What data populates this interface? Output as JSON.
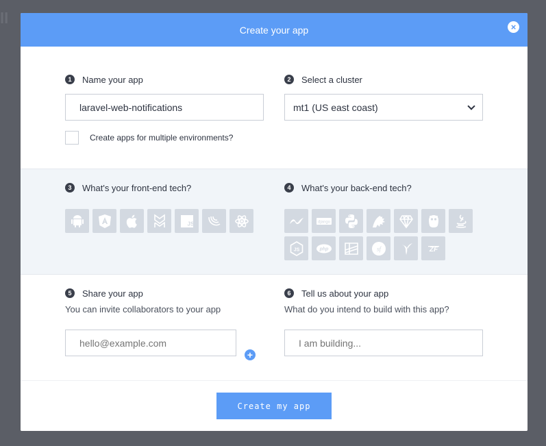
{
  "modal": {
    "title": "Create your app",
    "close_symbol": "×"
  },
  "name_app": {
    "step": "1",
    "label": "Name your app",
    "value": "laravel-web-notifications"
  },
  "cluster": {
    "step": "2",
    "label": "Select a cluster",
    "selected": "mt1 (US east coast)"
  },
  "multi_env": {
    "label": "Create apps for multiple environments?",
    "checked": false
  },
  "frontend": {
    "step": "3",
    "label": "What's your front-end tech?",
    "items": [
      {
        "name": "android-icon"
      },
      {
        "name": "angular-icon"
      },
      {
        "name": "apple-icon"
      },
      {
        "name": "backbone-icon"
      },
      {
        "name": "js-icon",
        "text": "JS"
      },
      {
        "name": "jquery-icon"
      },
      {
        "name": "react-icon"
      }
    ]
  },
  "backend": {
    "step": "4",
    "label": "What's your back-end tech?",
    "items": [
      {
        "name": "dotnet-icon"
      },
      {
        "name": "django-icon",
        "text": "django"
      },
      {
        "name": "python-icon"
      },
      {
        "name": "laravel-icon"
      },
      {
        "name": "ruby-icon"
      },
      {
        "name": "go-icon"
      },
      {
        "name": "java-icon"
      },
      {
        "name": "nodejs-icon",
        "text": "JS"
      },
      {
        "name": "php-icon",
        "text": "php"
      },
      {
        "name": "rails-icon"
      },
      {
        "name": "symfony-icon",
        "text": "sf"
      },
      {
        "name": "yii-icon"
      },
      {
        "name": "zend-icon",
        "text": "ZF"
      }
    ]
  },
  "share": {
    "step": "5",
    "label": "Share your app",
    "sub": "You can invite collaborators to your app",
    "placeholder": "hello@example.com",
    "add_symbol": "+"
  },
  "about": {
    "step": "6",
    "label": "Tell us about your app",
    "sub": "What do you intend to build with this app?",
    "placeholder": "I am building..."
  },
  "submit": {
    "label": "Create my app"
  },
  "colors": {
    "accent": "#5c9cf6",
    "tile": "#d3d9e1",
    "backdrop": "#5b5e66"
  }
}
